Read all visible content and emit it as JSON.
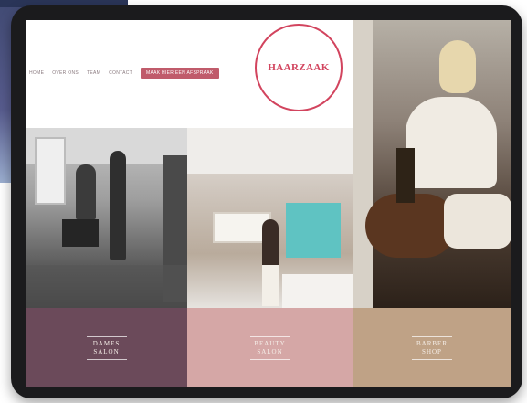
{
  "nav": {
    "items": [
      "HOME",
      "OVER ONS",
      "TEAM",
      "CONTACT"
    ],
    "cta": "MAAK HIER EEN AFSPRAAK"
  },
  "logo": {
    "text": "HAARZAAK"
  },
  "tiles": [
    {
      "line1": "DAMES",
      "line2": "SALON"
    },
    {
      "line1": "BEAUTY",
      "line2": "SALON"
    },
    {
      "line1": "BARBER",
      "line2": "SHOP"
    }
  ],
  "colors": {
    "brand": "#d2445e",
    "tile_dames": "#6b4a5a",
    "tile_beauty": "#d5a7a6",
    "tile_barber": "#bfa286"
  }
}
